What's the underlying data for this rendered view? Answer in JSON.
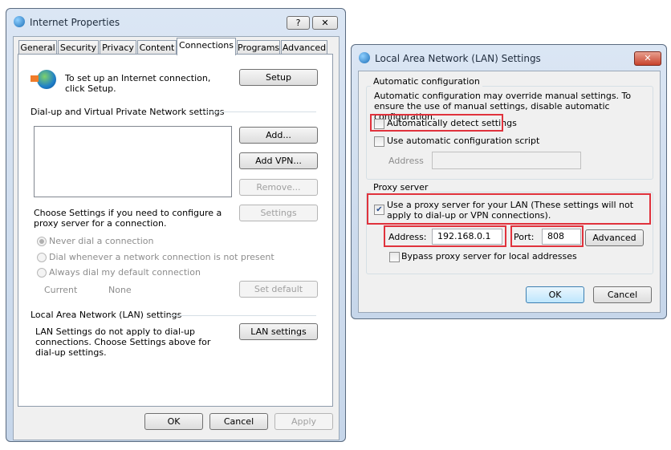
{
  "internet_properties": {
    "title": "Internet Properties",
    "help_icon": "?",
    "close_icon": "✕",
    "tabs": [
      "General",
      "Security",
      "Privacy",
      "Content",
      "Connections",
      "Programs",
      "Advanced"
    ],
    "active_tab": "Connections",
    "setup_text": "To set up an Internet connection, click Setup.",
    "setup_button": "Setup",
    "vpn_section": "Dial-up and Virtual Private Network settings",
    "add_button": "Add...",
    "add_vpn_button": "Add VPN...",
    "remove_button": "Remove...",
    "settings_text": "Choose Settings if you need to configure a proxy server for a connection.",
    "settings_button": "Settings",
    "radios": [
      "Never dial a connection",
      "Dial whenever a network connection is not present",
      "Always dial my default connection"
    ],
    "current_label": "Current",
    "current_value": "None",
    "set_default_button": "Set default",
    "lan_section": "Local Area Network (LAN) settings",
    "lan_text": "LAN Settings do not apply to dial-up connections. Choose Settings above for dial-up settings.",
    "lan_button": "LAN settings",
    "ok": "OK",
    "cancel": "Cancel",
    "apply": "Apply"
  },
  "lan_settings": {
    "title": "Local Area Network (LAN) Settings",
    "close_icon": "✕",
    "auto_group": "Automatic configuration",
    "auto_desc": "Automatic configuration may override manual settings.  To ensure the use of manual settings, disable automatic configuration.",
    "auto_detect": "Automatically detect settings",
    "auto_detect_checked": false,
    "use_script": "Use automatic configuration script",
    "use_script_checked": false,
    "script_address_label": "Address",
    "script_address_value": "",
    "proxy_group": "Proxy server",
    "use_proxy": "Use a proxy server for your LAN (These settings will not apply to dial-up or VPN connections).",
    "use_proxy_checked": true,
    "address_label": "Address:",
    "address_value": "192.168.0.1",
    "port_label": "Port:",
    "port_value": "808",
    "advanced_button": "Advanced",
    "bypass": "Bypass proxy server for local addresses",
    "bypass_checked": false,
    "ok": "OK",
    "cancel": "Cancel",
    "highlight_color": "#e0323c"
  }
}
